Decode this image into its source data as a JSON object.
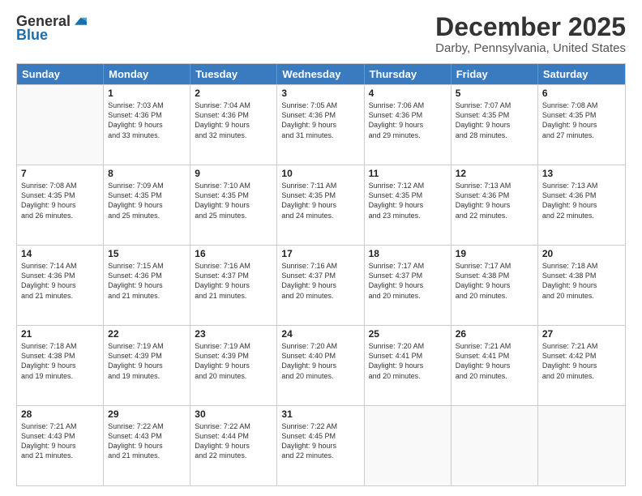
{
  "logo": {
    "general": "General",
    "blue": "Blue"
  },
  "header": {
    "month": "December 2025",
    "location": "Darby, Pennsylvania, United States"
  },
  "days_of_week": [
    "Sunday",
    "Monday",
    "Tuesday",
    "Wednesday",
    "Thursday",
    "Friday",
    "Saturday"
  ],
  "weeks": [
    [
      {
        "day": "",
        "sunrise": "",
        "sunset": "",
        "daylight": "",
        "empty": true
      },
      {
        "day": "1",
        "sunrise": "Sunrise: 7:03 AM",
        "sunset": "Sunset: 4:36 PM",
        "daylight": "Daylight: 9 hours",
        "daylight2": "and 33 minutes.",
        "empty": false
      },
      {
        "day": "2",
        "sunrise": "Sunrise: 7:04 AM",
        "sunset": "Sunset: 4:36 PM",
        "daylight": "Daylight: 9 hours",
        "daylight2": "and 32 minutes.",
        "empty": false
      },
      {
        "day": "3",
        "sunrise": "Sunrise: 7:05 AM",
        "sunset": "Sunset: 4:36 PM",
        "daylight": "Daylight: 9 hours",
        "daylight2": "and 31 minutes.",
        "empty": false
      },
      {
        "day": "4",
        "sunrise": "Sunrise: 7:06 AM",
        "sunset": "Sunset: 4:36 PM",
        "daylight": "Daylight: 9 hours",
        "daylight2": "and 29 minutes.",
        "empty": false
      },
      {
        "day": "5",
        "sunrise": "Sunrise: 7:07 AM",
        "sunset": "Sunset: 4:35 PM",
        "daylight": "Daylight: 9 hours",
        "daylight2": "and 28 minutes.",
        "empty": false
      },
      {
        "day": "6",
        "sunrise": "Sunrise: 7:08 AM",
        "sunset": "Sunset: 4:35 PM",
        "daylight": "Daylight: 9 hours",
        "daylight2": "and 27 minutes.",
        "empty": false
      }
    ],
    [
      {
        "day": "7",
        "sunrise": "Sunrise: 7:08 AM",
        "sunset": "Sunset: 4:35 PM",
        "daylight": "Daylight: 9 hours",
        "daylight2": "and 26 minutes.",
        "empty": false
      },
      {
        "day": "8",
        "sunrise": "Sunrise: 7:09 AM",
        "sunset": "Sunset: 4:35 PM",
        "daylight": "Daylight: 9 hours",
        "daylight2": "and 25 minutes.",
        "empty": false
      },
      {
        "day": "9",
        "sunrise": "Sunrise: 7:10 AM",
        "sunset": "Sunset: 4:35 PM",
        "daylight": "Daylight: 9 hours",
        "daylight2": "and 25 minutes.",
        "empty": false
      },
      {
        "day": "10",
        "sunrise": "Sunrise: 7:11 AM",
        "sunset": "Sunset: 4:35 PM",
        "daylight": "Daylight: 9 hours",
        "daylight2": "and 24 minutes.",
        "empty": false
      },
      {
        "day": "11",
        "sunrise": "Sunrise: 7:12 AM",
        "sunset": "Sunset: 4:35 PM",
        "daylight": "Daylight: 9 hours",
        "daylight2": "and 23 minutes.",
        "empty": false
      },
      {
        "day": "12",
        "sunrise": "Sunrise: 7:13 AM",
        "sunset": "Sunset: 4:36 PM",
        "daylight": "Daylight: 9 hours",
        "daylight2": "and 22 minutes.",
        "empty": false
      },
      {
        "day": "13",
        "sunrise": "Sunrise: 7:13 AM",
        "sunset": "Sunset: 4:36 PM",
        "daylight": "Daylight: 9 hours",
        "daylight2": "and 22 minutes.",
        "empty": false
      }
    ],
    [
      {
        "day": "14",
        "sunrise": "Sunrise: 7:14 AM",
        "sunset": "Sunset: 4:36 PM",
        "daylight": "Daylight: 9 hours",
        "daylight2": "and 21 minutes.",
        "empty": false
      },
      {
        "day": "15",
        "sunrise": "Sunrise: 7:15 AM",
        "sunset": "Sunset: 4:36 PM",
        "daylight": "Daylight: 9 hours",
        "daylight2": "and 21 minutes.",
        "empty": false
      },
      {
        "day": "16",
        "sunrise": "Sunrise: 7:16 AM",
        "sunset": "Sunset: 4:37 PM",
        "daylight": "Daylight: 9 hours",
        "daylight2": "and 21 minutes.",
        "empty": false
      },
      {
        "day": "17",
        "sunrise": "Sunrise: 7:16 AM",
        "sunset": "Sunset: 4:37 PM",
        "daylight": "Daylight: 9 hours",
        "daylight2": "and 20 minutes.",
        "empty": false
      },
      {
        "day": "18",
        "sunrise": "Sunrise: 7:17 AM",
        "sunset": "Sunset: 4:37 PM",
        "daylight": "Daylight: 9 hours",
        "daylight2": "and 20 minutes.",
        "empty": false
      },
      {
        "day": "19",
        "sunrise": "Sunrise: 7:17 AM",
        "sunset": "Sunset: 4:38 PM",
        "daylight": "Daylight: 9 hours",
        "daylight2": "and 20 minutes.",
        "empty": false
      },
      {
        "day": "20",
        "sunrise": "Sunrise: 7:18 AM",
        "sunset": "Sunset: 4:38 PM",
        "daylight": "Daylight: 9 hours",
        "daylight2": "and 20 minutes.",
        "empty": false
      }
    ],
    [
      {
        "day": "21",
        "sunrise": "Sunrise: 7:18 AM",
        "sunset": "Sunset: 4:38 PM",
        "daylight": "Daylight: 9 hours",
        "daylight2": "and 19 minutes.",
        "empty": false
      },
      {
        "day": "22",
        "sunrise": "Sunrise: 7:19 AM",
        "sunset": "Sunset: 4:39 PM",
        "daylight": "Daylight: 9 hours",
        "daylight2": "and 19 minutes.",
        "empty": false
      },
      {
        "day": "23",
        "sunrise": "Sunrise: 7:19 AM",
        "sunset": "Sunset: 4:39 PM",
        "daylight": "Daylight: 9 hours",
        "daylight2": "and 20 minutes.",
        "empty": false
      },
      {
        "day": "24",
        "sunrise": "Sunrise: 7:20 AM",
        "sunset": "Sunset: 4:40 PM",
        "daylight": "Daylight: 9 hours",
        "daylight2": "and 20 minutes.",
        "empty": false
      },
      {
        "day": "25",
        "sunrise": "Sunrise: 7:20 AM",
        "sunset": "Sunset: 4:41 PM",
        "daylight": "Daylight: 9 hours",
        "daylight2": "and 20 minutes.",
        "empty": false
      },
      {
        "day": "26",
        "sunrise": "Sunrise: 7:21 AM",
        "sunset": "Sunset: 4:41 PM",
        "daylight": "Daylight: 9 hours",
        "daylight2": "and 20 minutes.",
        "empty": false
      },
      {
        "day": "27",
        "sunrise": "Sunrise: 7:21 AM",
        "sunset": "Sunset: 4:42 PM",
        "daylight": "Daylight: 9 hours",
        "daylight2": "and 20 minutes.",
        "empty": false
      }
    ],
    [
      {
        "day": "28",
        "sunrise": "Sunrise: 7:21 AM",
        "sunset": "Sunset: 4:43 PM",
        "daylight": "Daylight: 9 hours",
        "daylight2": "and 21 minutes.",
        "empty": false
      },
      {
        "day": "29",
        "sunrise": "Sunrise: 7:22 AM",
        "sunset": "Sunset: 4:43 PM",
        "daylight": "Daylight: 9 hours",
        "daylight2": "and 21 minutes.",
        "empty": false
      },
      {
        "day": "30",
        "sunrise": "Sunrise: 7:22 AM",
        "sunset": "Sunset: 4:44 PM",
        "daylight": "Daylight: 9 hours",
        "daylight2": "and 22 minutes.",
        "empty": false
      },
      {
        "day": "31",
        "sunrise": "Sunrise: 7:22 AM",
        "sunset": "Sunset: 4:45 PM",
        "daylight": "Daylight: 9 hours",
        "daylight2": "and 22 minutes.",
        "empty": false
      },
      {
        "day": "",
        "sunrise": "",
        "sunset": "",
        "daylight": "",
        "daylight2": "",
        "empty": true
      },
      {
        "day": "",
        "sunrise": "",
        "sunset": "",
        "daylight": "",
        "daylight2": "",
        "empty": true
      },
      {
        "day": "",
        "sunrise": "",
        "sunset": "",
        "daylight": "",
        "daylight2": "",
        "empty": true
      }
    ]
  ]
}
